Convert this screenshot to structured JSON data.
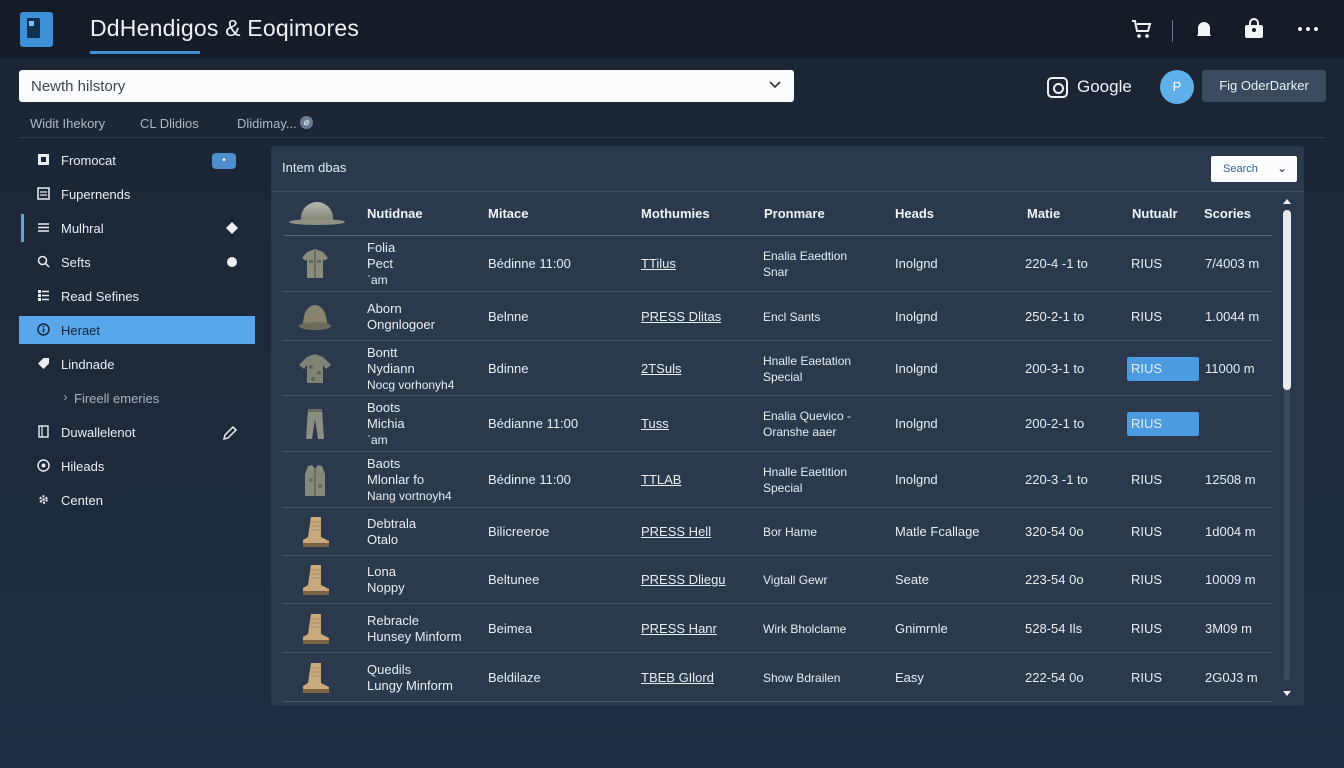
{
  "header": {
    "app_title": "DdHendigos & Eoqimores",
    "icons": [
      "cart-icon",
      "bell-icon",
      "bag-icon",
      "more-icon"
    ]
  },
  "search": {
    "placeholder": "Newth hilstory",
    "google_label": "Google",
    "avatar_initial": "P",
    "dark_toggle_label": "Fig OderDarker"
  },
  "crumbs": [
    "Widit  Ihekory",
    "CL Dlidios",
    "Dlidimay..."
  ],
  "sidebar": {
    "items": [
      {
        "label": "Fromocat",
        "icon": "grid-icon",
        "badge": "•"
      },
      {
        "label": "Fupernends",
        "icon": "doc-icon"
      },
      {
        "label": "Mulhral",
        "icon": "list-icon",
        "trail_icon": "diamond-icon"
      },
      {
        "label": "Sefts",
        "icon": "search-icon",
        "trail_icon": "dot-icon"
      },
      {
        "label": "Read Sefines",
        "icon": "rows-icon"
      },
      {
        "label": "Heraet",
        "icon": "info-icon",
        "active": true
      },
      {
        "label": "Lindnade",
        "icon": "tag-icon"
      },
      {
        "label": "Fireell emeries",
        "icon": "chevron-right-icon",
        "sub": true
      },
      {
        "label": "Duwallelenot",
        "icon": "book-icon",
        "trail_icon": "pencil-icon"
      },
      {
        "label": "Hileads",
        "icon": "eye-icon"
      },
      {
        "label": "Centen",
        "icon": "gear-icon"
      }
    ]
  },
  "panel": {
    "title": "Intem dbas",
    "search_label": "Search",
    "columns": [
      "Nutidnae",
      "Mitace",
      "Mothumies",
      "Pronmare",
      "Heads",
      "Matie",
      "Nutualr",
      "Scories"
    ],
    "rows": [
      {
        "name": [
          "Folia",
          "Pect",
          "ˈam"
        ],
        "mitace": "Bédinne 11:00",
        "moth": "TTilus",
        "pron": [
          "Enalia Eaedtion",
          "Snar"
        ],
        "heads": "Inolgnd",
        "matie": "220-4 -1 to",
        "nut": "RIUS",
        "score": "7/4003 m",
        "thumb": "jacket"
      },
      {
        "name": [
          "Aborn",
          "Ongnlogoer"
        ],
        "mitace": "Belnne",
        "moth": "PRESS Dlitas",
        "pron": [
          "Encl Sants"
        ],
        "heads": "Inolgnd",
        "matie": "250-2-1 to",
        "nut": "RIUS",
        "score": "1.0044 m",
        "thumb": "helmet"
      },
      {
        "name": [
          "Bontt",
          "Nydiann",
          "Nocg vorhonyh4"
        ],
        "mitace": "Bdinne",
        "moth": "2TSuls",
        "pron": [
          "Hnalle Eaetation",
          "Special"
        ],
        "heads": "Inolgnd",
        "matie": "200-3-1 to",
        "nut": "RIUS",
        "score": "11000 m",
        "thumb": "shirt",
        "highlight": true
      },
      {
        "name": [
          "Boots",
          "Michia",
          "ˈam"
        ],
        "mitace": "Bédianne 11:00",
        "moth": "Tuss",
        "pron": [
          "Enalia Quevico -",
          "Oranshe aaer"
        ],
        "heads": "Inolgnd",
        "matie": "200-2-1 to",
        "nut": "RIUS",
        "score": "",
        "thumb": "pants",
        "highlight": true
      },
      {
        "name": [
          "Baots",
          "Mlonlar fo",
          "Nang vortnoyh4"
        ],
        "mitace": "Bédinne 11:00",
        "moth": "TTLAB",
        "pron": [
          "Hnalle Eaetition",
          "Special"
        ],
        "heads": "Inolgnd",
        "matie": "220-3 -1 to",
        "nut": "RIUS",
        "score": "12508 m",
        "thumb": "vest"
      },
      {
        "name": [
          "Debtrala",
          "Otalo"
        ],
        "mitace": "Bilicreeroe",
        "moth": "PRESS Hell",
        "pron": [
          "Bor Hame"
        ],
        "heads": "Matle Fcallage",
        "matie": "320-54 0o",
        "nut": "RIUS",
        "score": "1d004 m",
        "thumb": "boot"
      },
      {
        "name": [
          "Lona",
          "Noppy"
        ],
        "mitace": "Beltunee",
        "moth": "PRESS Dliegu",
        "pron": [
          "Vigtall Gewr"
        ],
        "heads": "Seate",
        "matie": "223-54 0o",
        "nut": "RIUS",
        "score": "10009 m",
        "thumb": "boot"
      },
      {
        "name": [
          "Rebracle",
          "Hunsey Minform"
        ],
        "mitace": "Beimea",
        "moth": "PRESS Hanr",
        "pron": [
          "Wirk Bholclame"
        ],
        "heads": "Gnimrnle",
        "matie": "528-54 Ils",
        "nut": "RIUS",
        "score": "3M09 m",
        "thumb": "boot"
      },
      {
        "name": [
          "Quedils",
          "Lungy Minform"
        ],
        "mitace": "Beldilaze",
        "moth": "TBEB GIlord",
        "pron": [
          "Show Bdrailen"
        ],
        "heads": "Easy",
        "matie": "222-54 0o",
        "nut": "RIUS",
        "score": "2G0J3 m",
        "thumb": "boot"
      }
    ]
  },
  "colors": {
    "accent": "#5aa6ea",
    "panel_bg": "#2b394c",
    "page_bg": "#1e2a3b"
  }
}
